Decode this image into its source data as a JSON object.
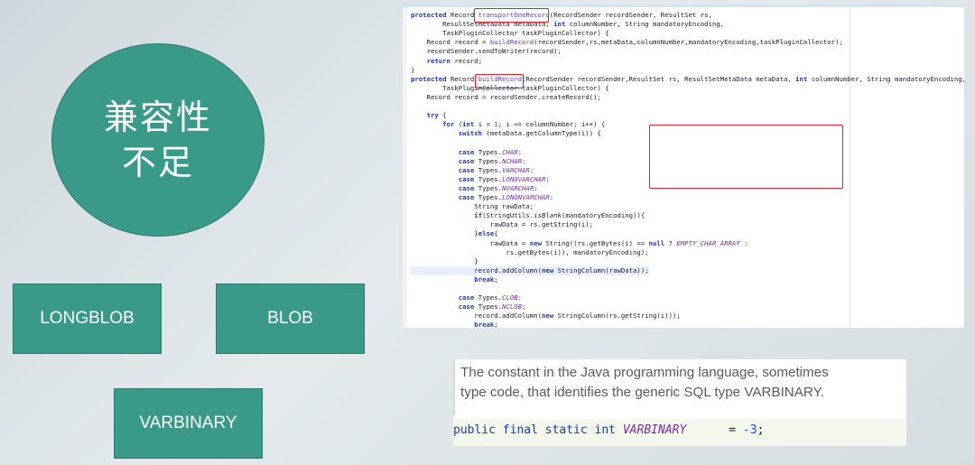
{
  "ellipse": {
    "line1": "兼容性",
    "line2": "不足"
  },
  "boxes": {
    "longblob": "LONGBLOB",
    "blob": "BLOB",
    "varbinary": "VARBINARY"
  },
  "code": {
    "lines": [
      "protected Record transportOneRecord(RecordSender recordSender, ResultSet rs,",
      "        ResultSetMetaData metaData, int columnNumber, String mandatoryEncoding,",
      "        TaskPluginCollector taskPluginCollector) {",
      "    Record record = buildRecord(recordSender,rs,metaData,columnNumber,mandatoryEncoding,taskPluginCollector);",
      "    recordSender.sendToWriter(record);",
      "    return record;",
      "}",
      "protected Record buildRecord(RecordSender recordSender,ResultSet rs, ResultSetMetaData metaData, int columnNumber, String mandatoryEncoding,",
      "        TaskPluginCollector taskPluginCollector) {",
      "    Record record = recordSender.createRecord();",
      "",
      "    try {",
      "        for (int i = 1; i <= columnNumber; i++) {",
      "            switch (metaData.getColumnType(i)) {",
      "",
      "            case Types.CHAR:",
      "            case Types.NCHAR:",
      "            case Types.VARCHAR:",
      "            case Types.LONGVARCHAR:",
      "            case Types.NVARCHAR:",
      "            case Types.LONGNVARCHAR:",
      "                String rawData;",
      "                if(StringUtils.isBlank(mandatoryEncoding)){",
      "                    rawData = rs.getString(i);",
      "                }else{",
      "                    rawData = new String((rs.getBytes(i) == null ? EMPTY_CHAR_ARRAY :",
      "                        rs.getBytes(i)), mandatoryEncoding);",
      "                }",
      "                record.addColumn(new StringColumn(rawData));",
      "                break;",
      "",
      "            case Types.CLOB:",
      "            case Types.NCLOB:",
      "                record.addColumn(new StringColumn(rs.getString(i)));",
      "                break;"
    ]
  },
  "doc": {
    "desc_line1": "The constant in the Java programming language, sometimes",
    "desc_line2": "type code, that identifies the generic SQL type VARBINARY.",
    "decl_prefix": "public final static int ",
    "decl_name": "VARBINARY",
    "decl_suffix": "      = ",
    "decl_value": "-3",
    "decl_end": ";"
  },
  "colors": {
    "teal": "#3a9a8a",
    "highlight_red": "#e0202a",
    "keyword": "#1a3bb0",
    "constant": "#7a2ea8"
  }
}
